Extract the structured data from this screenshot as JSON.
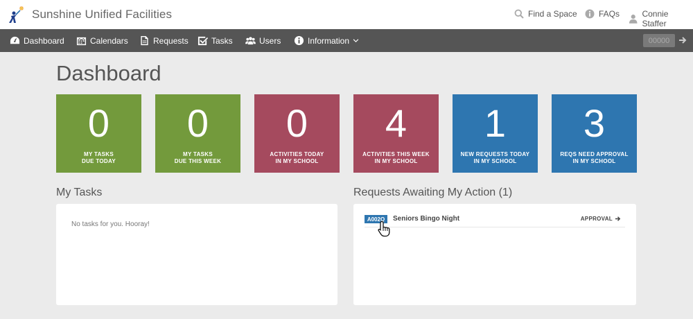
{
  "app": {
    "name": "Sunshine Unified Facilities"
  },
  "header": {
    "find_space": "Find a Space",
    "faqs": "FAQs",
    "user": "Connie Staffer"
  },
  "nav": {
    "items": [
      {
        "label": "Dashboard",
        "icon": "dashboard-icon"
      },
      {
        "label": "Calendars",
        "icon": "calendar-icon"
      },
      {
        "label": "Requests",
        "icon": "document-icon"
      },
      {
        "label": "Tasks",
        "icon": "checkbox-icon"
      },
      {
        "label": "Users",
        "icon": "users-icon"
      },
      {
        "label": "Information",
        "icon": "info-icon"
      }
    ],
    "search_placeholder": "00000"
  },
  "page": {
    "title": "Dashboard"
  },
  "tiles": [
    {
      "value": "0",
      "line1": "MY TASKS",
      "line2": "DUE TODAY",
      "color": "#739a3c"
    },
    {
      "value": "0",
      "line1": "MY TASKS",
      "line2": "DUE THIS WEEK",
      "color": "#739a3c"
    },
    {
      "value": "0",
      "line1": "ACTIVITIES TODAY",
      "line2": "IN MY SCHOOL",
      "color": "#a54a5e"
    },
    {
      "value": "4",
      "line1": "ACTIVITIES THIS WEEK",
      "line2": "IN MY SCHOOL",
      "color": "#a54a5e"
    },
    {
      "value": "1",
      "line1": "NEW REQUESTS TODAY",
      "line2": "IN MY SCHOOL",
      "color": "#2e76b0"
    },
    {
      "value": "3",
      "line1": "REQS NEED APPROVAL",
      "line2": "IN MY SCHOOL",
      "color": "#2e76b0"
    }
  ],
  "my_tasks": {
    "title": "My Tasks",
    "empty_message": "No tasks for you. Hooray!"
  },
  "requests": {
    "title": "Requests Awaiting My Action (1)",
    "items": [
      {
        "id": "A002Q",
        "name": "Seniors Bingo Night",
        "action": "APPROVAL"
      }
    ]
  }
}
